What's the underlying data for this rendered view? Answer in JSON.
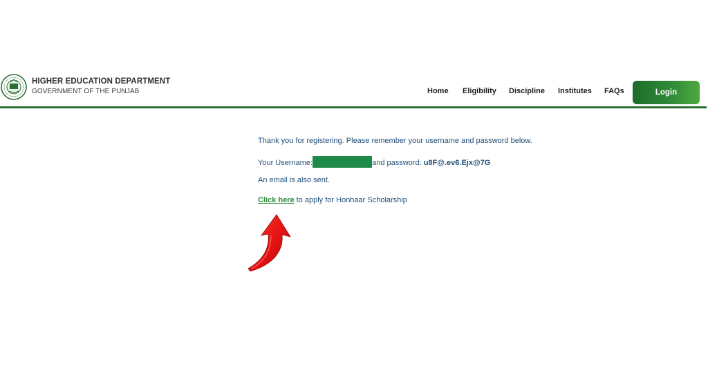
{
  "header": {
    "title": "HIGHER EDUCATION DEPARTMENT",
    "subtitle": "GOVERNMENT OF THE PUNJAB",
    "nav": [
      "Home",
      "Eligibility",
      "Discipline",
      "Institutes",
      "FAQs"
    ],
    "login_label": "Login"
  },
  "main": {
    "thanks_text": "Thank you for registering. Please remember your username and password below.",
    "username_label": "Your Username:",
    "password_label": "and password:",
    "password_value": "u8F@.ev6.Ejx@7G",
    "email_text": "An email is also sent.",
    "click_here_label": "Click here",
    "apply_text": " to apply for Honhaar Scholarship"
  },
  "icons": {
    "logo": "punjab-government-seal-icon",
    "annotation": "red-curved-arrow-icon"
  },
  "colors": {
    "brand_green": "#2a6e33",
    "text_blue": "#1f4e79",
    "link_green": "#2f8a3c",
    "redaction": "#1e8a4a",
    "arrow_red": "#e01010"
  }
}
